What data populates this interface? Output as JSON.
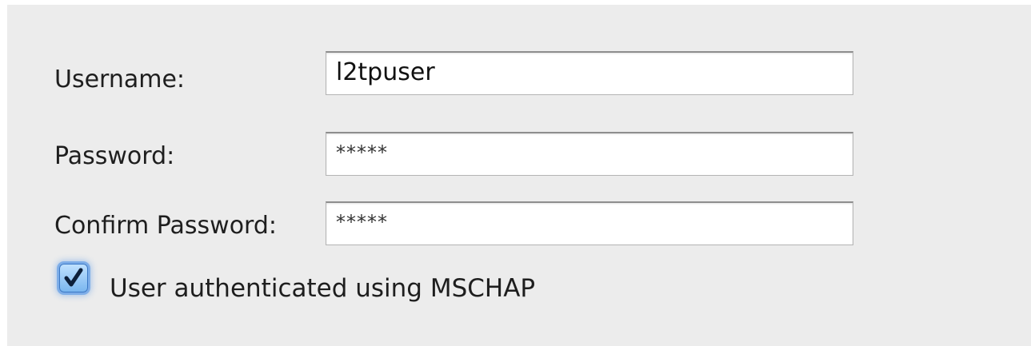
{
  "form": {
    "username": {
      "label": "Username:",
      "value": "l2tpuser"
    },
    "password": {
      "label": "Password:",
      "value": "*****"
    },
    "confirm_password": {
      "label": "Confirm Password:",
      "value": "*****"
    },
    "mschap": {
      "label": "User authenticated using MSCHAP",
      "checked": true,
      "icon": "checkmark-icon"
    }
  },
  "colors": {
    "panel_background": "#ececec",
    "field_background": "#ffffff",
    "checkbox_accent": "#3b78c5"
  }
}
